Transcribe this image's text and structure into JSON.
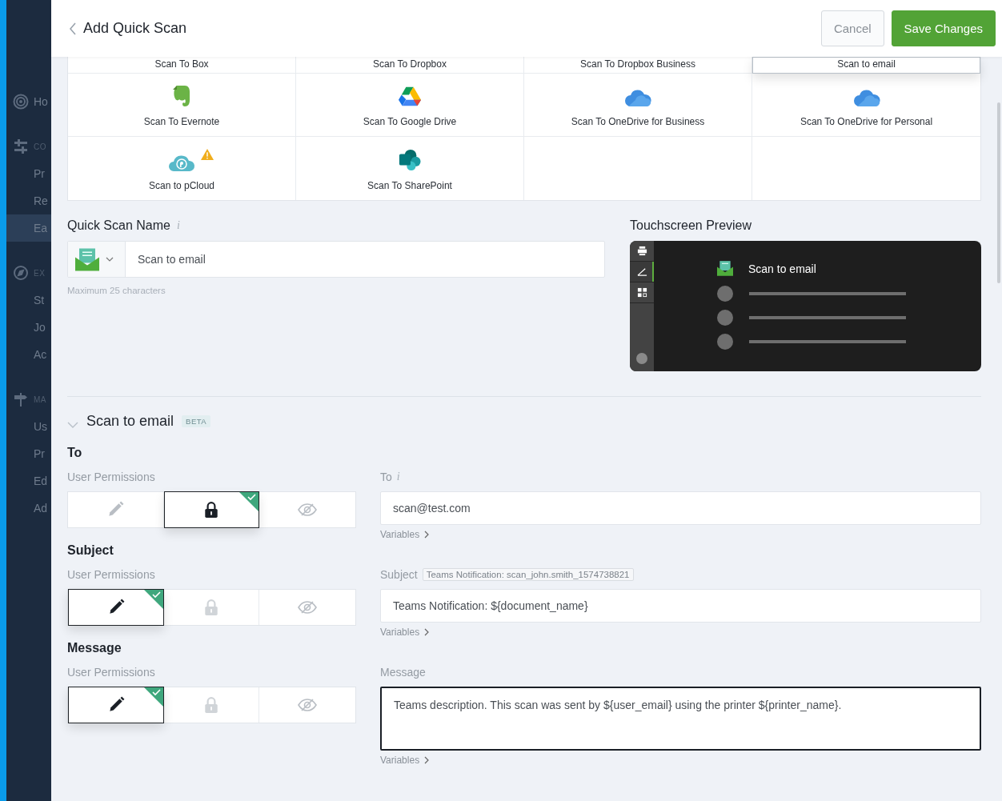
{
  "sidebar": {
    "items": [
      {
        "kind": "link",
        "label": "Ho",
        "selected": false
      },
      {
        "kind": "heading",
        "label": "CO"
      },
      {
        "kind": "link",
        "label": "Pr",
        "selected": false
      },
      {
        "kind": "link",
        "label": "Re",
        "selected": false
      },
      {
        "kind": "link",
        "label": "Ea",
        "selected": true
      },
      {
        "kind": "heading",
        "label": "EX"
      },
      {
        "kind": "link",
        "label": "St",
        "selected": false
      },
      {
        "kind": "link",
        "label": "Jo",
        "selected": false
      },
      {
        "kind": "link",
        "label": "Ac",
        "selected": false
      },
      {
        "kind": "heading",
        "label": "MA"
      },
      {
        "kind": "link",
        "label": "Us",
        "selected": false
      },
      {
        "kind": "link",
        "label": "Pr",
        "selected": false
      },
      {
        "kind": "link",
        "label": "Ed",
        "selected": false
      },
      {
        "kind": "link",
        "label": "Ad",
        "selected": false
      }
    ]
  },
  "header": {
    "title": "Add Quick Scan",
    "buttons": [
      {
        "label": "Cancel",
        "kind": "secondary"
      },
      {
        "label": "Save Changes",
        "kind": "primary"
      }
    ]
  },
  "destinations": [
    {
      "label": "Scan To Box",
      "kind": "plain",
      "selected": false
    },
    {
      "label": "Scan To Dropbox",
      "kind": "plain",
      "selected": false
    },
    {
      "label": "Scan To Dropbox Business",
      "kind": "plain",
      "selected": false
    },
    {
      "label": "Scan to email",
      "kind": "plain",
      "selected": true
    },
    {
      "label": "Scan To Evernote",
      "kind": "evernote",
      "selected": false,
      "warning": false
    },
    {
      "label": "Scan To Google Drive",
      "kind": "gdrive",
      "selected": false,
      "warning": false
    },
    {
      "label": "Scan To OneDrive for Business",
      "kind": "onedrive",
      "selected": false,
      "warning": false
    },
    {
      "label": "Scan To OneDrive for Personal",
      "kind": "onedrive",
      "selected": false,
      "warning": false
    },
    {
      "label": "Scan to pCloud",
      "kind": "pcloud",
      "selected": false,
      "warning": true
    },
    {
      "label": "Scan To SharePoint",
      "kind": "sharepoint",
      "selected": false,
      "warning": false
    }
  ],
  "name_field": {
    "label": "Quick Scan Name",
    "info": "i",
    "value": "Scan to email",
    "hint": "Maximum 25 characters"
  },
  "preview": {
    "title": "Touchscreen Preview",
    "item_label": "Scan to email",
    "rail": [
      {
        "selected": false
      },
      {
        "selected": true
      },
      {
        "selected": false
      }
    ]
  },
  "section": {
    "title": "Scan to email",
    "badge": "BETA",
    "expanded": true
  },
  "fields": [
    {
      "title": "To",
      "permissions_label": "User Permissions",
      "permissions": [
        {
          "kind": "edit",
          "selected": false
        },
        {
          "kind": "lock",
          "selected": true
        },
        {
          "kind": "hide",
          "selected": false
        }
      ],
      "label": "To",
      "info": "i",
      "kind": "input",
      "value": "scan@test.com",
      "link": "Variables",
      "focused": false
    },
    {
      "title": "Subject",
      "permissions_label": "User Permissions",
      "permissions": [
        {
          "kind": "edit",
          "selected": true
        },
        {
          "kind": "lock",
          "selected": false
        },
        {
          "kind": "hide",
          "selected": false
        }
      ],
      "label": "Subject",
      "tag": "Teams Notification: scan_john.smith_1574738821",
      "kind": "input",
      "value": "Teams Notification: ${document_name}",
      "link": "Variables",
      "focused": false
    },
    {
      "title": "Message",
      "permissions_label": "User Permissions",
      "permissions": [
        {
          "kind": "edit",
          "selected": true
        },
        {
          "kind": "lock",
          "selected": false
        },
        {
          "kind": "hide",
          "selected": false
        }
      ],
      "label": "Message",
      "kind": "textarea",
      "value": "Teams description. This scan was sent by ${user_email} using the printer ${printer_name}.",
      "link": "Variables",
      "focused": true
    }
  ]
}
